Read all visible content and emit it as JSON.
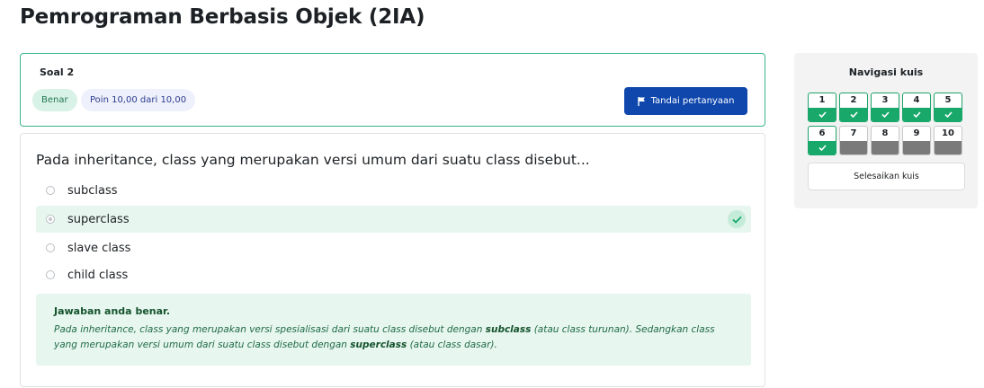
{
  "page": {
    "title": "Pemrograman Berbasis Objek (2IA)"
  },
  "question_info": {
    "title": "Soal 2",
    "status": "Benar",
    "score": "Poin 10,00 dari 10,00",
    "flag_label": "Tandai pertanyaan"
  },
  "question": {
    "text": "Pada inheritance, class yang merupakan versi umum dari suatu class disebut...",
    "options": [
      {
        "label": "subclass",
        "selected": false
      },
      {
        "label": "superclass",
        "selected": true
      },
      {
        "label": "slave class",
        "selected": false
      },
      {
        "label": "child class",
        "selected": false
      }
    ]
  },
  "feedback": {
    "title": "Jawaban anda benar.",
    "part1": "Pada inheritance, class yang merupakan versi spesialisasi dari suatu class disebut dengan ",
    "term1": "subclass",
    "part2": " (atau class turunan). Sedangkan class yang merupakan versi umum dari suatu class disebut dengan ",
    "term2": "superclass",
    "part3": " (atau class dasar)."
  },
  "nav": {
    "title": "Navigasi kuis",
    "questions": [
      {
        "num": "1",
        "answered": true
      },
      {
        "num": "2",
        "answered": true
      },
      {
        "num": "3",
        "answered": true
      },
      {
        "num": "4",
        "answered": true
      },
      {
        "num": "5",
        "answered": true
      },
      {
        "num": "6",
        "answered": true
      },
      {
        "num": "7",
        "answered": false
      },
      {
        "num": "8",
        "answered": false
      },
      {
        "num": "9",
        "answered": false
      },
      {
        "num": "10",
        "answered": false
      }
    ],
    "finish_label": "Selesaikan kuis"
  },
  "colors": {
    "primary": "#0f47ad",
    "success": "#18a86a",
    "success_bg": "#e7f6ef"
  }
}
